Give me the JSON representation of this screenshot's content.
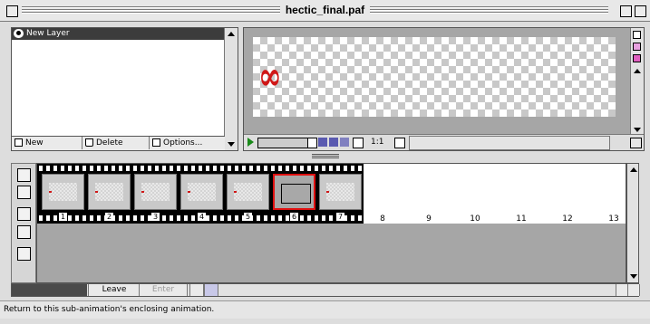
{
  "window": {
    "title": "hectic_final.paf"
  },
  "layers": {
    "items": [
      {
        "name": "New Layer"
      }
    ],
    "buttons": {
      "new": "New",
      "delete": "Delete",
      "options": "Options..."
    }
  },
  "preview": {
    "zoom": "1:1",
    "glyph": "∞"
  },
  "timeline": {
    "frames": [
      "1",
      "2",
      "3",
      "4",
      "5",
      "6",
      "7"
    ],
    "current_frame": 6,
    "empty_frames": [
      "8",
      "9",
      "10",
      "11",
      "12",
      "13"
    ]
  },
  "controls": {
    "leave": "Leave",
    "enter": "Enter"
  },
  "status": "Return to this sub-animation's enclosing animation.",
  "colors": {
    "selection": "#e01010",
    "content": "#d01818",
    "panel": "#a6a6a6"
  }
}
